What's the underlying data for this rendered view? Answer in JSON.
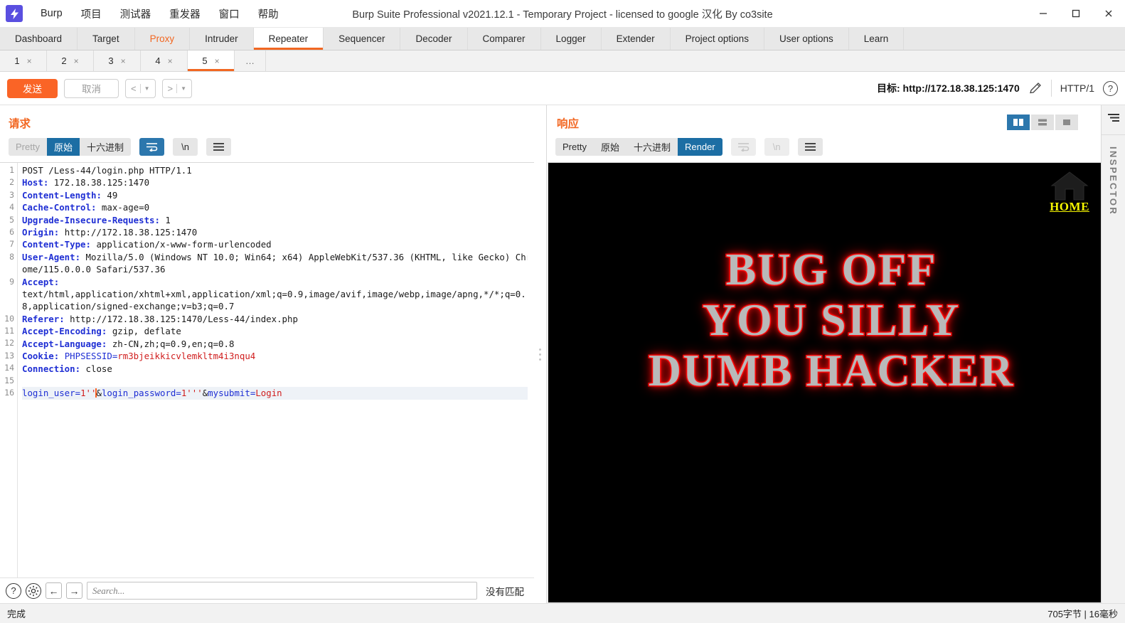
{
  "window": {
    "title": "Burp Suite Professional v2021.12.1 - Temporary Project - licensed to google 汉化 By co3site",
    "logo": "burp-lightning-icon",
    "minimize": "—",
    "maximize": "▢",
    "close": "✕"
  },
  "menubar": {
    "items": [
      {
        "label": "Burp"
      },
      {
        "label": "项目"
      },
      {
        "label": "测试器"
      },
      {
        "label": "重发器"
      },
      {
        "label": "窗口"
      },
      {
        "label": "帮助"
      }
    ]
  },
  "main_tabs": [
    {
      "label": "Dashboard",
      "active": false
    },
    {
      "label": "Target",
      "active": false
    },
    {
      "label": "Proxy",
      "active": false
    },
    {
      "label": "Intruder",
      "active": false
    },
    {
      "label": "Repeater",
      "active": true
    },
    {
      "label": "Sequencer",
      "active": false
    },
    {
      "label": "Decoder",
      "active": false
    },
    {
      "label": "Comparer",
      "active": false
    },
    {
      "label": "Logger",
      "active": false
    },
    {
      "label": "Extender",
      "active": false
    },
    {
      "label": "Project options",
      "active": false
    },
    {
      "label": "User options",
      "active": false
    },
    {
      "label": "Learn",
      "active": false
    }
  ],
  "repeater_tabs": [
    {
      "label": "1",
      "close": "×",
      "active": false
    },
    {
      "label": "2",
      "close": "×",
      "active": false
    },
    {
      "label": "3",
      "close": "×",
      "active": false
    },
    {
      "label": "4",
      "close": "×",
      "active": false
    },
    {
      "label": "5",
      "close": "×",
      "active": true
    },
    {
      "label": "…",
      "close": "",
      "active": false
    }
  ],
  "actionbar": {
    "send": "发送",
    "cancel": "取消",
    "back": "<",
    "forward": ">",
    "target_label": "目标: http://172.18.38.125:1470",
    "edit_icon": "pencil-icon",
    "http_version": "HTTP/1",
    "help_icon": "?"
  },
  "request": {
    "title": "请求",
    "view_tabs": [
      {
        "label": "Pretty",
        "state": "muted"
      },
      {
        "label": "原始",
        "state": "selected"
      },
      {
        "label": "十六进制",
        "state": "normal"
      }
    ],
    "icon_buttons": [
      {
        "name": "word-wrap-icon",
        "state": "selected"
      },
      {
        "name": "newline-icon",
        "label": "\\n",
        "state": "normal"
      },
      {
        "name": "hamburger-menu-icon",
        "state": "normal"
      }
    ],
    "line_numbers": [
      "1",
      "2",
      "3",
      "4",
      "5",
      "6",
      "7",
      "8",
      "",
      "9",
      "",
      "",
      "10",
      "11",
      "12",
      "13",
      "14",
      "15",
      "16"
    ],
    "lines": [
      {
        "n": 1,
        "header": "POST /Less-44/login.php HTTP/1.1",
        "plain": true
      },
      {
        "n": 2,
        "header": "Host",
        "value": " 172.18.38.125:1470"
      },
      {
        "n": 3,
        "header": "Content-Length",
        "value": " 49"
      },
      {
        "n": 4,
        "header": "Cache-Control",
        "value": " max-age=0"
      },
      {
        "n": 5,
        "header": "Upgrade-Insecure-Requests",
        "value": " 1"
      },
      {
        "n": 6,
        "header": "Origin",
        "value": " http://172.18.38.125:1470"
      },
      {
        "n": 7,
        "header": "Content-Type",
        "value": " application/x-www-form-urlencoded"
      },
      {
        "n": 8,
        "header": "User-Agent",
        "value": " Mozilla/5.0 (Windows NT 10.0; Win64; x64) AppleWebKit/537.36 (KHTML, like Gecko) Chrome/115.0.0.0 Safari/537.36"
      },
      {
        "n": 9,
        "header": "Accept",
        "value": "\ntext/html,application/xhtml+xml,application/xml;q=0.9,image/avif,image/webp,image/apng,*/*;q=0.8,application/signed-exchange;v=b3;q=0.7"
      },
      {
        "n": 10,
        "header": "Referer",
        "value": " http://172.18.38.125:1470/Less-44/index.php"
      },
      {
        "n": 11,
        "header": "Accept-Encoding",
        "value": " gzip, deflate"
      },
      {
        "n": 12,
        "header": "Accept-Language",
        "value": " zh-CN,zh;q=0.9,en;q=0.8"
      },
      {
        "n": 13,
        "header": "Cookie",
        "value": " PHPSESSID=",
        "cookie_value": "rm3bjeikkicvlemkltm4i3nqu4"
      },
      {
        "n": 14,
        "header": "Connection",
        "value": " close"
      },
      {
        "n": 15,
        "header": "",
        "value": ""
      }
    ],
    "body": {
      "p1_name": "login_user",
      "p1_eq": "=",
      "p1_val": "1''",
      "amp1": "&",
      "p2_name": "login_password",
      "p2_eq": "=",
      "p2_val": "1'''",
      "amp2": "&",
      "p3_name": "mysubmit",
      "p3_eq": "=",
      "p3_val": "Login"
    }
  },
  "response": {
    "title": "响应",
    "view_tabs": [
      {
        "label": "Pretty",
        "state": "normal"
      },
      {
        "label": "原始",
        "state": "normal"
      },
      {
        "label": "十六进制",
        "state": "normal"
      },
      {
        "label": "Render",
        "state": "selected"
      }
    ],
    "icon_buttons": [
      {
        "name": "word-wrap-icon",
        "state": "disabled"
      },
      {
        "name": "newline-icon",
        "label": "\\n",
        "state": "disabled"
      },
      {
        "name": "hamburger-menu-icon",
        "state": "normal"
      }
    ],
    "layout_toggles": [
      {
        "name": "side-by-side-layout-icon",
        "active": true
      },
      {
        "name": "stacked-layout-icon",
        "active": false
      },
      {
        "name": "single-pane-layout-icon",
        "active": false
      }
    ],
    "rendered_page": {
      "home_link": "HOME",
      "home_icon": "house-icon",
      "headline_line1": "BUG OFF",
      "headline_line2": "YOU SILLY",
      "headline_line3": "DUMB HACKER",
      "background_color": "#000000",
      "headline_fill": "#b9b9b9",
      "headline_outline": "#ee0000",
      "home_link_color": "#f5f500"
    }
  },
  "search": {
    "help_icon": "?",
    "settings_icon": "gear-icon",
    "prev_icon": "←",
    "next_icon": "→",
    "placeholder": "Search...",
    "value": "",
    "result": "没有匹配"
  },
  "inspector": {
    "collapse_icon": "collapse-panel-icon",
    "label": "INSPECTOR"
  },
  "statusbar": {
    "left": "完成",
    "right": "705字节 | 16毫秒"
  },
  "colors": {
    "accent_orange": "#f26722",
    "send_button": "#fa6426",
    "tab_selected_blue": "#1c6ea4",
    "header_blue": "#1f2fd4",
    "value_red": "#d01d1d"
  }
}
